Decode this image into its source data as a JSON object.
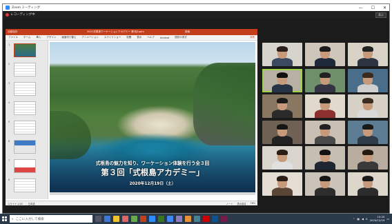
{
  "window": {
    "title": "Zoom ミーティング",
    "minimize": "—",
    "maximize": "☐",
    "close": "✕"
  },
  "zoom_bar": {
    "recording_label": "レコーディング中",
    "view_button": "表示"
  },
  "ppt": {
    "autosave": "自動保存",
    "doc_title": "2021式根島ワーケーションアカデミー 第3回.pptx",
    "search": "検索",
    "ribbon": [
      "ファイル",
      "ホーム",
      "挿入",
      "デザイン",
      "画面切り替え",
      "アニメーション",
      "スライドショー",
      "校閲",
      "表示",
      "ヘルプ",
      "Acrobat",
      "図形の書式"
    ],
    "share": "共有",
    "thumbs": [
      "1",
      "2",
      "3",
      "4",
      "5",
      "6",
      "7",
      "8"
    ],
    "status_left": "スライド 1/18",
    "status_lang": "日本語",
    "status_notes": "ノート",
    "status_display": "表示設定",
    "status_zoom": "76%"
  },
  "slide": {
    "subtitle": "式根島の魅力を知り、ワーケーション体験を行う全３回",
    "title": "第３回「式根島アカデミー」",
    "date": "2020年12月19日（土）"
  },
  "gallery": {
    "tiles": [
      {
        "bg": "#d7d3cd",
        "shirt": "#3b4a5f",
        "hair": "#2a1f1a"
      },
      {
        "bg": "#cfc6bb",
        "shirt": "#1e2a3a",
        "hair": "#1a1a1a"
      },
      {
        "bg": "#d9d2c6",
        "shirt": "#2c3440",
        "hair": "#222"
      },
      {
        "bg": "#b9b0a4",
        "shirt": "#253344",
        "hair": "#111"
      },
      {
        "bg": "#6f8f6a",
        "shirt": "#334",
        "hair": "#222"
      },
      {
        "bg": "#4a6e8a",
        "shirt": "#cfcfcf",
        "hair": "#3a2a1c"
      },
      {
        "bg": "#8a7762",
        "shirt": "#2a2a2a",
        "hair": "#1b1b1b"
      },
      {
        "bg": "#e0d9cc",
        "shirt": "#8b2f2f",
        "hair": "#1d1d1d"
      },
      {
        "bg": "#d6d0c7",
        "shirt": "#d9d9d9",
        "hair": "#3b2b20"
      },
      {
        "bg": "#6f6255",
        "shirt": "#222",
        "hair": "#151515"
      },
      {
        "bg": "#c9c0b3",
        "shirt": "#4a4a4a",
        "hair": "#222"
      },
      {
        "bg": "#5c7d93",
        "shirt": "#2f3b49",
        "hair": "#1a1a1a"
      },
      {
        "bg": "#d9d4cc",
        "shirt": "#e0e0e0",
        "hair": "#2a1d14"
      },
      {
        "bg": "#c5beb2",
        "shirt": "#1f2733",
        "hair": "#121212"
      },
      {
        "bg": "#b8ad9e",
        "shirt": "#3a3a3a",
        "hair": "#241a12"
      },
      {
        "bg": "#e3ddd4",
        "shirt": "#5a4636",
        "hair": "#2b1e16"
      },
      {
        "bg": "#c9c3ba",
        "shirt": "#2d2d2d",
        "hair": "#161616"
      },
      {
        "bg": "#dcd6cb",
        "shirt": "#2c2c2c",
        "hair": "#1a1a1a"
      }
    ]
  },
  "taskbar": {
    "search_placeholder": "ここに入力して検索",
    "time": "15:20",
    "date": "2020/12/19",
    "ime": "A"
  },
  "colors": {
    "ppt_accent": "#c43e1c",
    "active_speaker": "#9fd44a",
    "taskbar": "#2b3a4a"
  }
}
